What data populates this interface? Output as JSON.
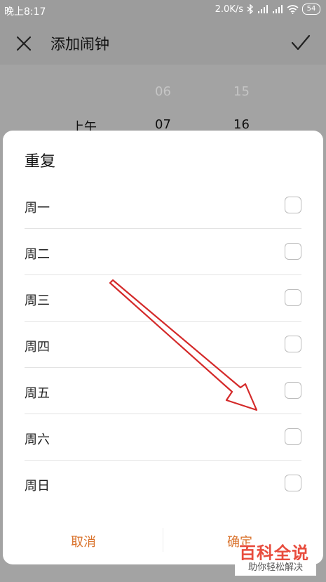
{
  "status_bar": {
    "time": "晚上8:17",
    "speed": "2.0K/s",
    "battery": "54",
    "icons": [
      "bluetooth-icon",
      "signal-icon",
      "signal-icon",
      "wifi-icon",
      "battery-icon"
    ]
  },
  "header": {
    "title": "添加闹钟",
    "close_icon": "close-icon",
    "confirm_icon": "check-icon"
  },
  "time_picker": {
    "period": "上午",
    "hour_prev": "06",
    "hour_selected": "07",
    "minute_prev": "15",
    "minute_selected": "16"
  },
  "dialog": {
    "title": "重复",
    "days": [
      {
        "label": "周一",
        "checked": false
      },
      {
        "label": "周二",
        "checked": false
      },
      {
        "label": "周三",
        "checked": false
      },
      {
        "label": "周四",
        "checked": false
      },
      {
        "label": "周五",
        "checked": false
      },
      {
        "label": "周六",
        "checked": false
      },
      {
        "label": "周日",
        "checked": false
      }
    ],
    "cancel_label": "取消",
    "confirm_label": "确定"
  },
  "watermark": {
    "main": "百科全说",
    "sub": "助你轻松解决"
  },
  "colors": {
    "accent": "#d9712a",
    "overlay": "#9c9c9c",
    "arrow": "#d42a2a",
    "watermark": "#e84c3d"
  }
}
